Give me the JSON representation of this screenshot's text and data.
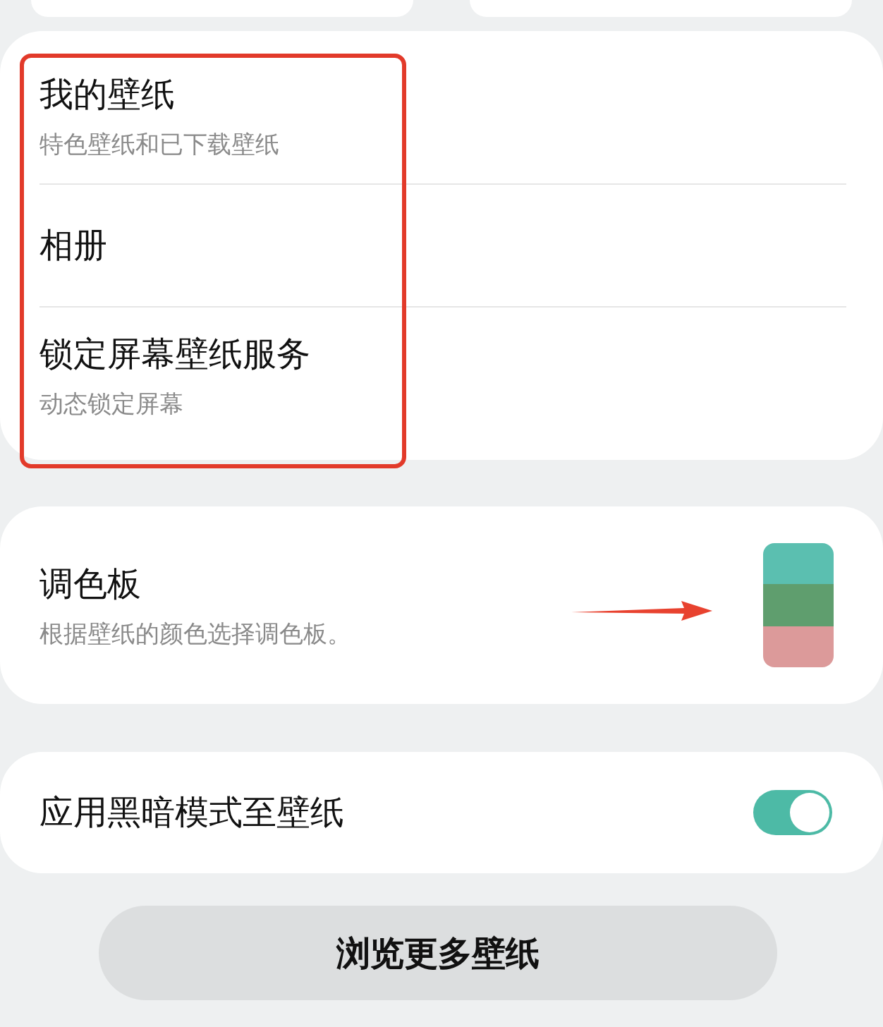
{
  "wallpaper_menu": [
    {
      "title": "我的壁纸",
      "subtitle": "特色壁纸和已下载壁纸"
    },
    {
      "title": "相册"
    },
    {
      "title": "锁定屏幕壁纸服务",
      "subtitle": "动态锁定屏幕"
    }
  ],
  "palette": {
    "title": "调色板",
    "subtitle": "根据壁纸的颜色选择调色板。",
    "swatches": [
      {
        "color": "#5bbfb0"
      },
      {
        "color": "#5f9e6e"
      },
      {
        "color": "#dc9a9a"
      }
    ]
  },
  "dark_mode": {
    "label": "应用黑暗模式至壁纸",
    "on": true
  },
  "browse_button": "浏览更多壁纸"
}
